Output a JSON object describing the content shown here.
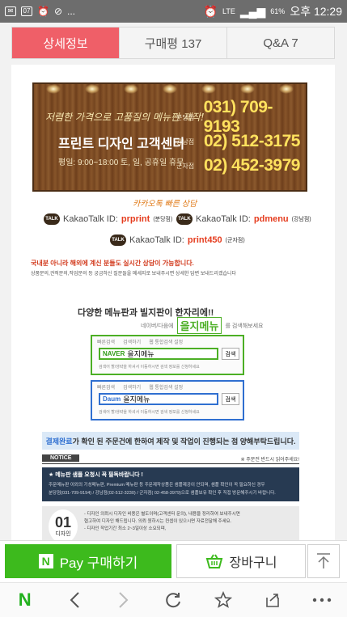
{
  "status": {
    "notif_badge": "07",
    "left_dots": "...",
    "network": "LTE",
    "battery": "61%",
    "time": "오후 12:29"
  },
  "tabs": [
    {
      "label": "상세정보",
      "active": true
    },
    {
      "label": "구매평 137",
      "active": false
    },
    {
      "label": "Q&A 7",
      "active": false
    }
  ],
  "banner": {
    "slogan": "저렴한 가격으로 고품질의 메뉴판 제작!",
    "title": "프린트 디자인 고객센터",
    "hours": "평일: 9:00~18:00 토, 일, 공휴일 휴무",
    "phones": [
      {
        "label": "분당점",
        "number": "031) 709-9193"
      },
      {
        "label": "강남점",
        "number": "02) 512-3175"
      },
      {
        "label": "군자점",
        "number": "02) 452-3979"
      }
    ]
  },
  "kakao": {
    "heading": "카카오톡 빠른 상담",
    "badge": "TALK",
    "brand": "KakaoTalk ID:",
    "ids": [
      {
        "id": "prprint",
        "note": "(분당점)"
      },
      {
        "id": "pdmenu",
        "note": "(강남점)"
      },
      {
        "id": "print450",
        "note": "(군자점)"
      }
    ],
    "notice1": "국내분 아니라 해외에 계신 분들도 실시간 상담이 가능합니다.",
    "notice2": "상품문의,견적문의,작업문의 등 궁금하신 질문들을 메세지로 보내주시면 상세한 답변 보내드리겠습니다"
  },
  "promo": {
    "title": "다양한 메뉴판과 빌지판이 한자리에!!",
    "sub_prefix": "네이버/다음에",
    "brand": "을지메뉴",
    "sub_suffix": "를 검색해보세요",
    "naver": {
      "top_left": "빠른검색",
      "top_mid": "검색하기",
      "top_right": "웹 통합검색 설정",
      "engine": "NAVER",
      "query": "을지메뉴",
      "button": "검색",
      "bottom": "검색어 할/생략을 하셔서 이동하시면 검색 정보를 신청하세요"
    },
    "daum": {
      "top_left": "빠른검색",
      "top_mid": "검색하기",
      "top_right": "웹 통합검색 설정",
      "engine": "Daum",
      "query": "을지메뉴",
      "button": "검색",
      "bottom": "검색어 할/생략을 하셔서 이동하시면 검색 정보를 신청하세요"
    }
  },
  "payment": {
    "highlight": "결제완료",
    "text": "가 확인 된 주문건에 한하여 제작 및 작업이 진행되는 점 양해부탁드립니다."
  },
  "notice": {
    "tag": "NOTICE",
    "right": "※ 주문전 반드시 읽어주세요!",
    "line1": "★ 메뉴판 샘플 요청시 꼭 필독바랍니다 !",
    "line2": "주문메뉴판 이외의 기성메뉴판, Premium 메뉴판 등 주문제작상품은 샘플제공이 안되며, 샘플 확인이 꼭 필요하신 경우",
    "line3": "분당점(031-709-9194) / 강남점(02-512-3230) / 군자점( 02-458-3979)으로 샘플보유 확인 후 직접 방문해주시기 바랍니다."
  },
  "step": {
    "num": "01",
    "label": "디자인",
    "lines": [
      "- 디자인 의뢰시 디자인 비용은 별도이며(고객센터 문의), 내용을 정리하여 보내주시면",
      "  협고하여 디자인 해드립니다. 의뢰 원하시는 컨셉이 있으시면 자료전달해 주세요.",
      "- 디자인 작업기간 최소 2~3일이상 소요되며,"
    ]
  },
  "actions": {
    "pay_badge": "N",
    "pay_label": "Pay 구매하기",
    "cart_label": "장바구니"
  },
  "toolbar": {
    "n_logo": "N"
  },
  "colors": {
    "tab_active": "#ef5f68",
    "pay_green": "#3dba1d",
    "phone_yellow": "#ffe25e",
    "kakao_red": "#e53d1f"
  }
}
